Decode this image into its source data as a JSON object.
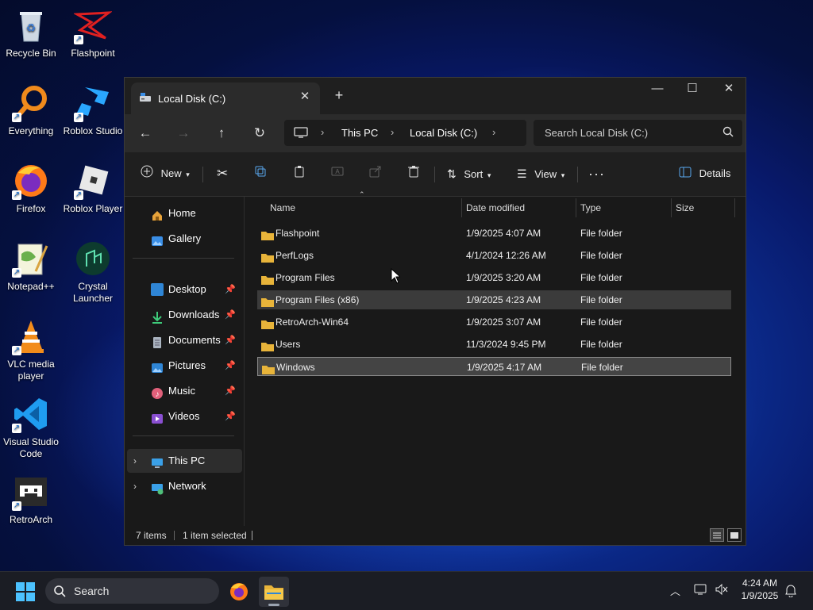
{
  "desktop": {
    "icons": [
      {
        "name": "recycle-bin-icon",
        "label": "Recycle Bin"
      },
      {
        "name": "flashpoint-icon",
        "label": "Flashpoint"
      },
      {
        "name": "everything-icon",
        "label": "Everything"
      },
      {
        "name": "roblox-studio-icon",
        "label": "Roblox Studio"
      },
      {
        "name": "firefox-icon",
        "label": "Firefox"
      },
      {
        "name": "roblox-player-icon",
        "label": "Roblox Player"
      },
      {
        "name": "notepadpp-icon",
        "label": "Notepad++"
      },
      {
        "name": "crystal-launcher-icon",
        "label": "Crystal Launcher"
      },
      {
        "name": "vlc-icon",
        "label": "VLC media player"
      },
      {
        "name": "vscode-icon",
        "label": "Visual Studio Code"
      },
      {
        "name": "retroarch-icon",
        "label": "RetroArch"
      }
    ]
  },
  "explorer": {
    "tab_title": "Local Disk (C:)",
    "breadcrumb": [
      "This PC",
      "Local Disk (C:)"
    ],
    "search_placeholder": "Search Local Disk (C:)",
    "toolbar": {
      "new_label": "New",
      "sort_label": "Sort",
      "view_label": "View",
      "details_label": "Details"
    },
    "nav": {
      "top": [
        {
          "label": "Home",
          "icon": "home-icon"
        },
        {
          "label": "Gallery",
          "icon": "gallery-icon"
        }
      ],
      "quick": [
        {
          "label": "Desktop",
          "icon": "desktop-folder-icon"
        },
        {
          "label": "Downloads",
          "icon": "downloads-icon"
        },
        {
          "label": "Documents",
          "icon": "documents-icon"
        },
        {
          "label": "Pictures",
          "icon": "pictures-icon"
        },
        {
          "label": "Music",
          "icon": "music-icon"
        },
        {
          "label": "Videos",
          "icon": "videos-icon"
        }
      ],
      "bottom": [
        {
          "label": "This PC",
          "icon": "this-pc-icon"
        },
        {
          "label": "Network",
          "icon": "network-icon"
        }
      ]
    },
    "columns": {
      "name": "Name",
      "date": "Date modified",
      "type": "Type",
      "size": "Size"
    },
    "files": [
      {
        "name": "Flashpoint",
        "date": "1/9/2025 4:07 AM",
        "type": "File folder"
      },
      {
        "name": "PerfLogs",
        "date": "4/1/2024 12:26 AM",
        "type": "File folder"
      },
      {
        "name": "Program Files",
        "date": "1/9/2025 3:20 AM",
        "type": "File folder"
      },
      {
        "name": "Program Files (x86)",
        "date": "1/9/2025 4:23 AM",
        "type": "File folder"
      },
      {
        "name": "RetroArch-Win64",
        "date": "1/9/2025 3:07 AM",
        "type": "File folder"
      },
      {
        "name": "Users",
        "date": "11/3/2024 9:45 PM",
        "type": "File folder"
      },
      {
        "name": "Windows",
        "date": "1/9/2025 4:17 AM",
        "type": "File folder"
      }
    ],
    "status": {
      "count": "7 items",
      "selected": "1 item selected"
    }
  },
  "taskbar": {
    "search_label": "Search",
    "time": "4:24 AM",
    "date": "1/9/2025"
  },
  "colors": {
    "folder": "#e8b43a",
    "accent": "#0078d4",
    "window_bg": "#191919"
  }
}
